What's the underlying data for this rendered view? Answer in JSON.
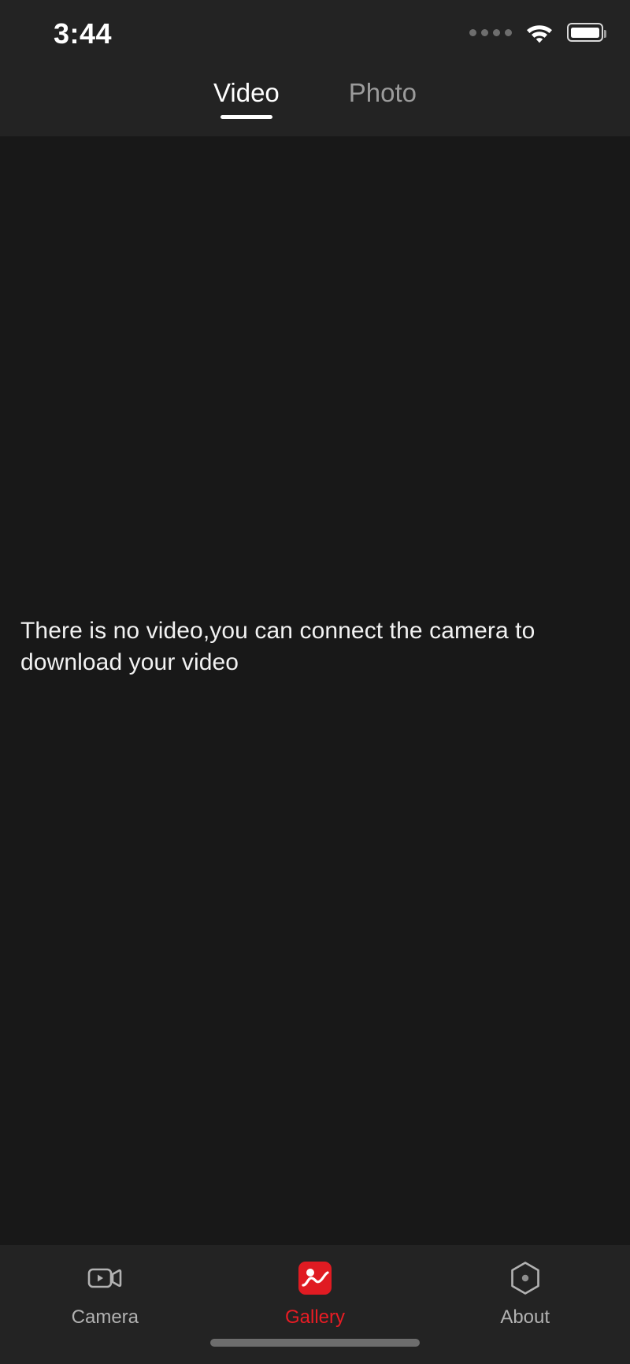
{
  "status_bar": {
    "time": "3:44",
    "signal_icon": "cellular-dots-icon",
    "signal_dots": 4,
    "wifi_icon": "wifi-icon",
    "battery_icon": "battery-icon",
    "battery_level_percent": 92
  },
  "top_tabs": {
    "items": [
      {
        "label": "Video",
        "active": true
      },
      {
        "label": "Photo",
        "active": false
      }
    ]
  },
  "content": {
    "empty_message": "There is no video,you can connect the camera to download your video"
  },
  "bottom_nav": {
    "items": [
      {
        "label": "Camera",
        "icon": "video-camera-icon",
        "active": false
      },
      {
        "label": "Gallery",
        "icon": "gallery-photo-icon",
        "active": true
      },
      {
        "label": "About",
        "icon": "hexagon-dot-icon",
        "active": false
      }
    ]
  },
  "colors": {
    "accent": "#ea1c24",
    "background": "#181818",
    "bar_background": "#232323",
    "text_primary": "#ffffff",
    "text_muted": "#9b9b9b"
  },
  "home_indicator": "home-indicator"
}
